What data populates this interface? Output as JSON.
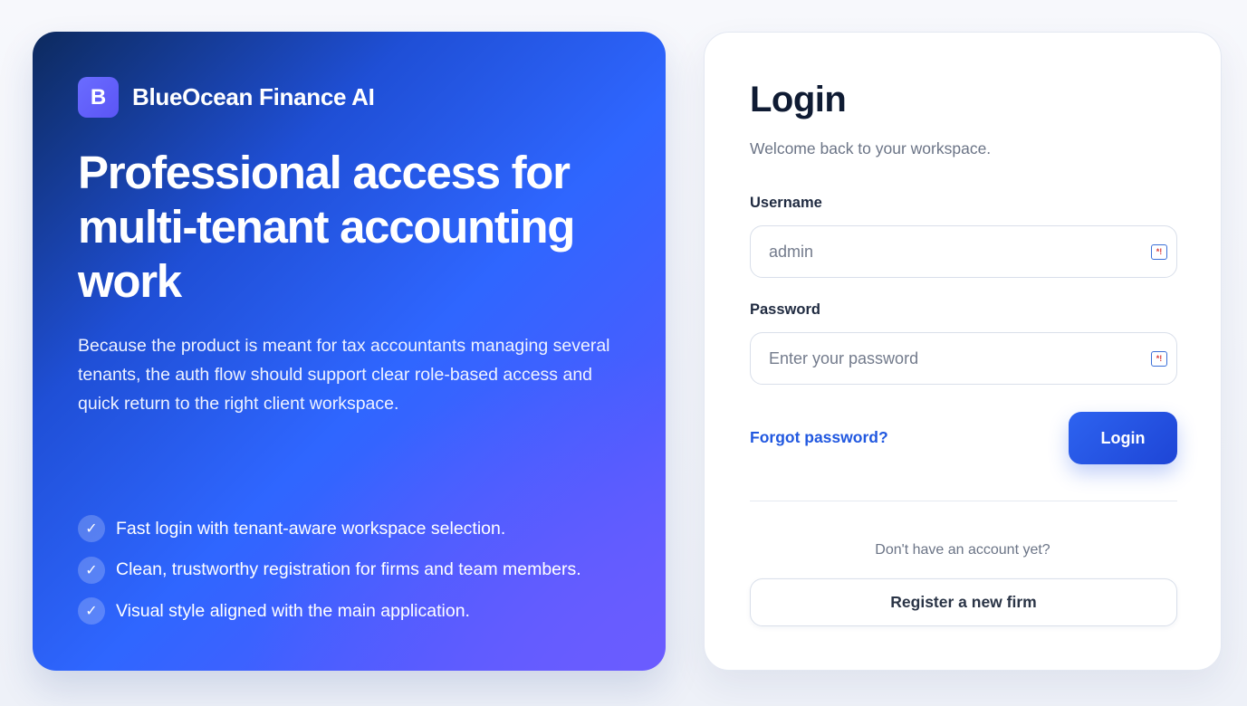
{
  "brand": {
    "logo_letter": "B",
    "name": "BlueOcean Finance AI"
  },
  "hero": {
    "title": "Professional access for multi-tenant accounting work",
    "description": "Because the product is meant for tax accountants managing several tenants, the auth flow should support clear role-based access and quick return to the right client workspace.",
    "features": [
      {
        "icon": "checkmark-icon",
        "glyph": "✓",
        "text": "Fast login with tenant-aware workspace selection."
      },
      {
        "icon": "checkmark-icon",
        "glyph": "✓",
        "text": "Clean, trustworthy registration for firms and team members."
      },
      {
        "icon": "checkmark-icon",
        "glyph": "✓",
        "text": "Visual style aligned with the main application."
      }
    ]
  },
  "login": {
    "title": "Login",
    "subtitle": "Welcome back to your workspace.",
    "username": {
      "label": "Username",
      "value": "",
      "placeholder": "admin",
      "icon": "password-manager-icon"
    },
    "password": {
      "label": "Password",
      "value": "",
      "placeholder": "Enter your password",
      "icon": "password-manager-icon"
    },
    "field_icon_glyph": "*!",
    "forgot_label": "Forgot password?",
    "submit_label": "Login",
    "no_account_text": "Don't have an account yet?",
    "register_label": "Register a new firm"
  },
  "colors": {
    "accent": "#2158e0",
    "hero_gradient_start": "#0d2a5e",
    "hero_gradient_end": "#6a5cff",
    "heading": "#0f1b33",
    "muted": "#6b7486"
  }
}
